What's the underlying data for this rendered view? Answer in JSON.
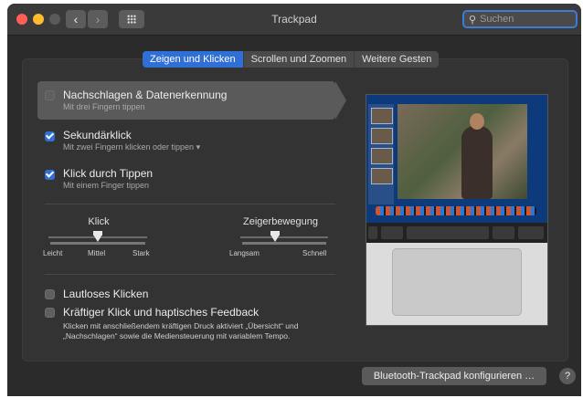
{
  "window": {
    "title": "Trackpad"
  },
  "search": {
    "placeholder": "Suchen",
    "icon": "search-icon"
  },
  "tabs": [
    {
      "label": "Zeigen und Klicken",
      "active": true
    },
    {
      "label": "Scrollen und Zoomen",
      "active": false
    },
    {
      "label": "Weitere Gesten",
      "active": false
    }
  ],
  "options": [
    {
      "title": "Nachschlagen & Datenerkennung",
      "subtitle": "Mit drei Fingern tippen",
      "checked": false,
      "highlighted": true
    },
    {
      "title": "Sekundärklick",
      "subtitle": "Mit zwei Fingern klicken oder tippen",
      "checked": true,
      "has_dropdown": true
    },
    {
      "title": "Klick durch Tippen",
      "subtitle": "Mit einem Finger tippen",
      "checked": true
    }
  ],
  "sliders": {
    "click": {
      "title": "Klick",
      "labels": [
        "Leicht",
        "Mittel",
        "Stark"
      ],
      "value_label": "Mittel"
    },
    "pointer": {
      "title": "Zeigerbewegung",
      "labels": [
        "Langsam",
        "Schnell"
      ]
    }
  },
  "bottom_options": [
    {
      "title": "Lautloses Klicken",
      "checked": false
    },
    {
      "title": "Kräftiger Klick und haptisches Feedback",
      "checked": false
    }
  ],
  "force_click_description": "Klicken mit anschließendem kräftigen Druck aktiviert „Übersicht“ und „Nachschlagen“ sowie die Mediensteuerung mit variablem Tempo.",
  "buttons": {
    "configure": "Bluetooth-Trackpad konfigurieren …",
    "help": "?"
  },
  "colors": {
    "accent": "#2f6fd6",
    "window_bg": "#2b2b2b"
  }
}
